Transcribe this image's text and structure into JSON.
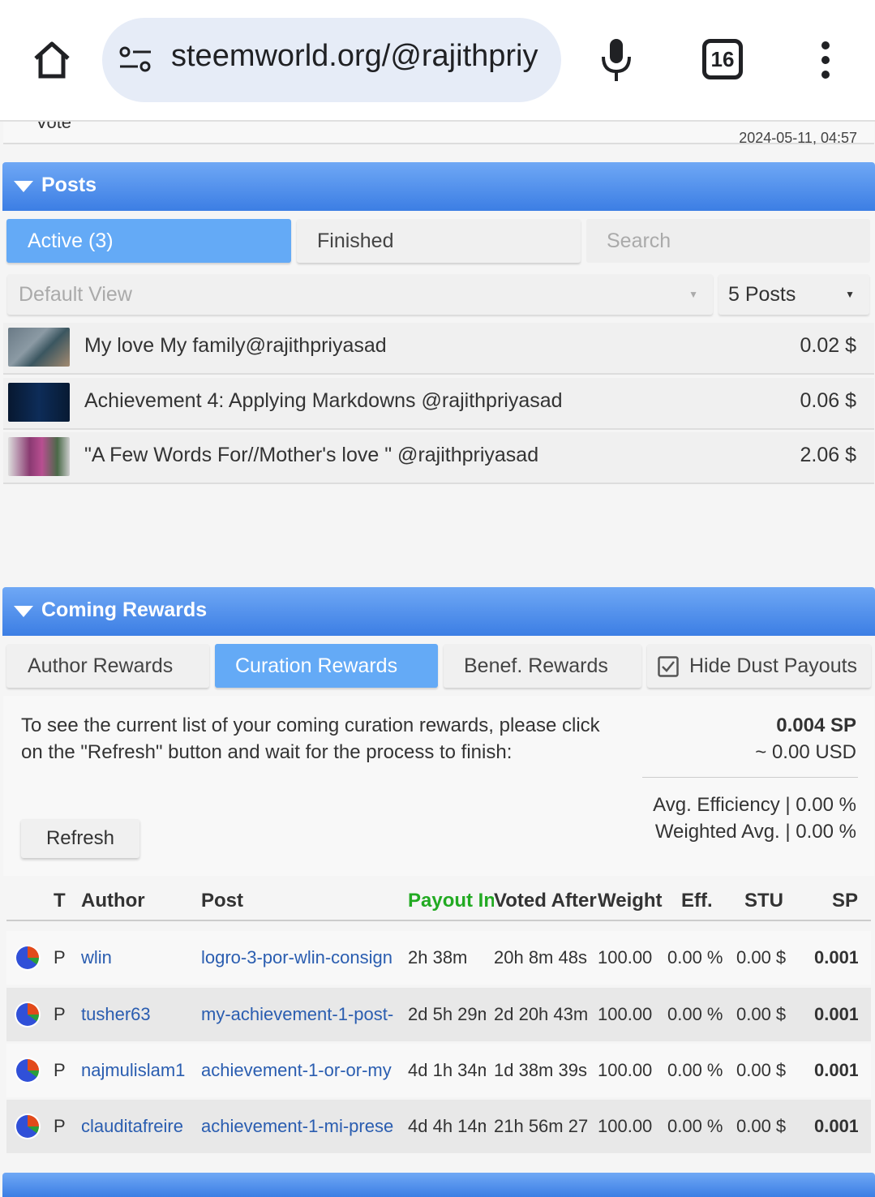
{
  "browser": {
    "url": "steemworld.org/@rajithpriy",
    "tab_count": "16"
  },
  "vote_row": {
    "label": "Vote",
    "date": "2024-05-11, 04:57"
  },
  "posts": {
    "title": "Posts",
    "tabs": [
      "Active (3)",
      "Finished",
      "Search"
    ],
    "view_select": "Default View",
    "count_select": "5 Posts",
    "items": [
      {
        "title": "My love My family@rajithpriyasad",
        "value": "0.02 $"
      },
      {
        "title": "Achievement 4: Applying Markdowns @rajithpriyasad",
        "value": "0.06 $"
      },
      {
        "title": "\"A Few Words For//Mother's love \" @rajithpriyasad",
        "value": "2.06 $"
      }
    ]
  },
  "rewards": {
    "title": "Coming Rewards",
    "tabs": [
      "Author Rewards",
      "Curation Rewards",
      "Benef. Rewards",
      "Hide Dust Payouts"
    ],
    "hide_dust_checked": true,
    "info": "To see the current list of your coming curation rewards, please click on the \"Refresh\" button and wait for the process to finish:",
    "sp_total": "0.004 SP",
    "usd_total": "~ 0.00 USD",
    "avg_efficiency": "Avg. Efficiency | 0.00 %",
    "weighted_avg": "Weighted Avg. | 0.00 %",
    "refresh_label": "Refresh",
    "columns": [
      "T",
      "Author",
      "Post",
      "Payout In",
      "Voted After",
      "Weight",
      "Eff.",
      "STU",
      "SP"
    ],
    "rows": [
      {
        "t": "P",
        "author": "wlin",
        "post": "logro-3-por-wlin-consign",
        "payout": "2h 38m",
        "voted": "20h 8m 48s",
        "weight": "100.00",
        "eff": "0.00 %",
        "stu": "0.00 $",
        "sp": "0.001"
      },
      {
        "t": "P",
        "author": "tusher63",
        "post": "my-achievement-1-post-",
        "payout": "2d 5h 29m",
        "voted": "2d 20h 43m",
        "weight": "100.00",
        "eff": "0.00 %",
        "stu": "0.00 $",
        "sp": "0.001"
      },
      {
        "t": "P",
        "author": "najmulislam1",
        "post": "achievement-1-or-or-my",
        "payout": "4d 1h 34m",
        "voted": "1d 38m 39s",
        "weight": "100.00",
        "eff": "0.00 %",
        "stu": "0.00 $",
        "sp": "0.001"
      },
      {
        "t": "P",
        "author": "clauditafreire",
        "post": "achievement-1-mi-prese",
        "payout": "4d 4h 14m",
        "voted": "21h 56m 27",
        "weight": "100.00",
        "eff": "0.00 %",
        "stu": "0.00 $",
        "sp": "0.001"
      }
    ]
  },
  "colors": {
    "accent": "#3c7ee4",
    "active_tab": "#64aaf6",
    "payout_header": "#22aa22",
    "link": "#2a5db0"
  }
}
